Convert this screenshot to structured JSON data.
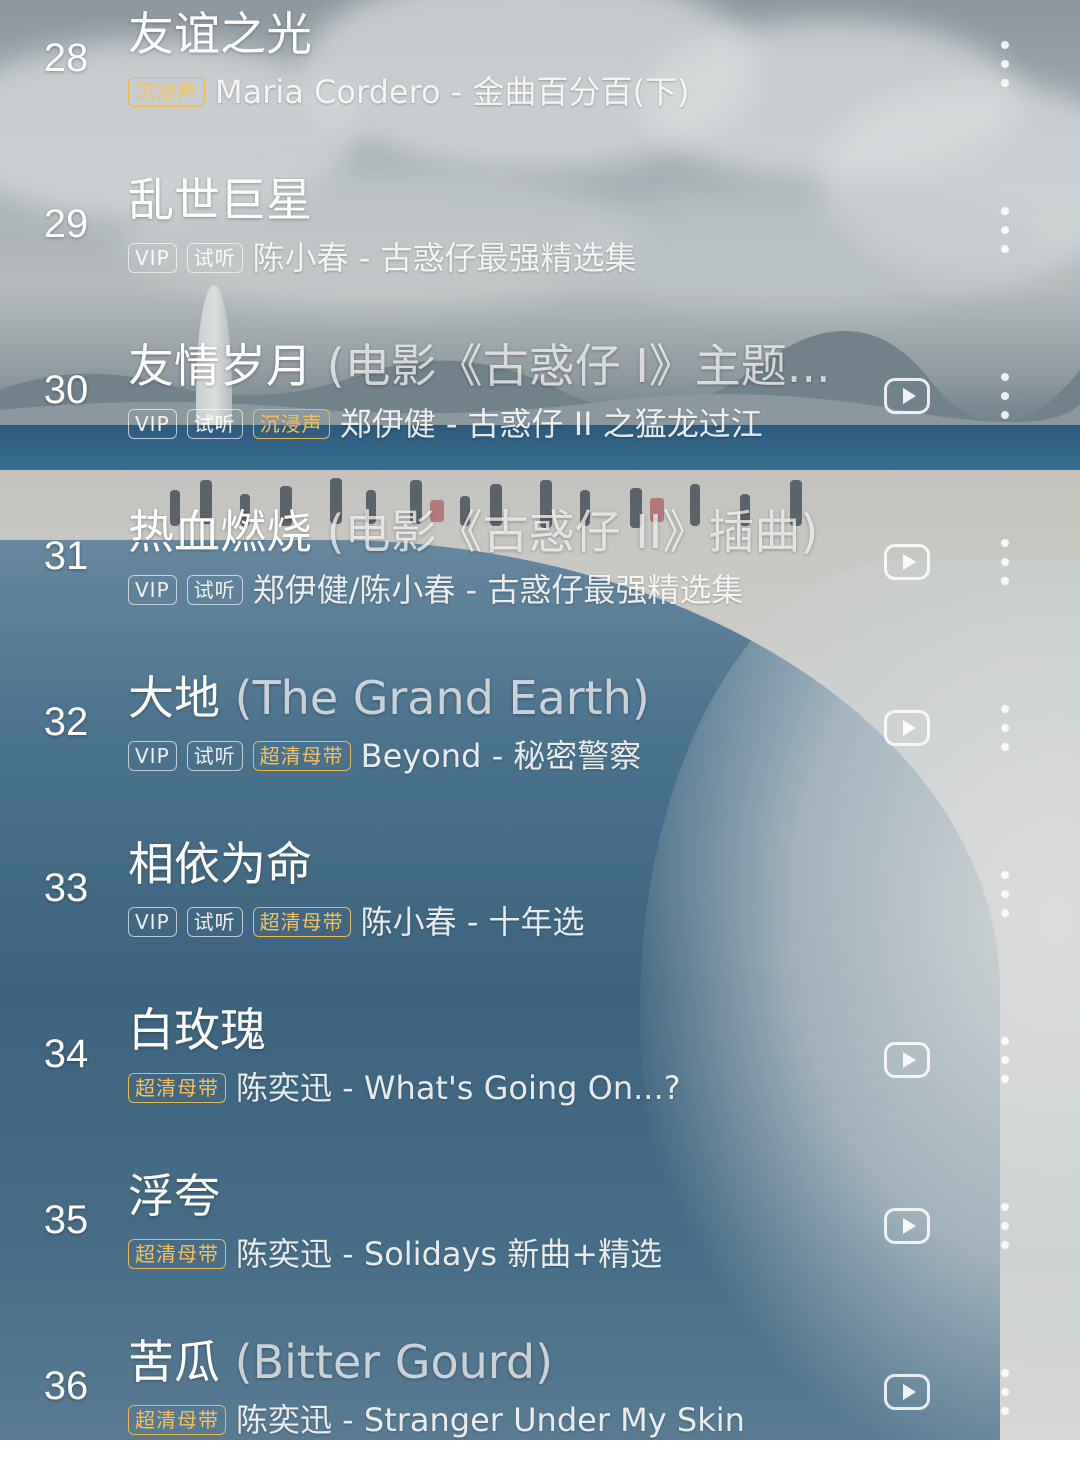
{
  "songs": [
    {
      "index": "28",
      "title": "友谊之光",
      "subtitle": "",
      "tags": [
        {
          "text": "沉浸声",
          "gold": true
        }
      ],
      "artist": "Maria Cordero - 金曲百分百(下)",
      "has_mv": false
    },
    {
      "index": "29",
      "title": "乱世巨星",
      "subtitle": "",
      "tags": [
        {
          "text": "VIP",
          "gold": false
        },
        {
          "text": "试听",
          "gold": false
        }
      ],
      "artist": "陈小春 - 古惑仔最强精选集",
      "has_mv": false
    },
    {
      "index": "30",
      "title": "友情岁月",
      "subtitle": "(电影《古惑仔 I》主题...",
      "tags": [
        {
          "text": "VIP",
          "gold": false
        },
        {
          "text": "试听",
          "gold": false
        },
        {
          "text": "沉浸声",
          "gold": true
        }
      ],
      "artist": "郑伊健 - 古惑仔 II 之猛龙过江",
      "has_mv": true
    },
    {
      "index": "31",
      "title": "热血燃烧",
      "subtitle": "(电影《古惑仔 II》插曲)",
      "tags": [
        {
          "text": "VIP",
          "gold": false
        },
        {
          "text": "试听",
          "gold": false
        }
      ],
      "artist": "郑伊健/陈小春 - 古惑仔最强精选集",
      "has_mv": true
    },
    {
      "index": "32",
      "title": "大地",
      "subtitle": "(The Grand Earth)",
      "tags": [
        {
          "text": "VIP",
          "gold": false
        },
        {
          "text": "试听",
          "gold": false
        },
        {
          "text": "超清母带",
          "gold": true
        }
      ],
      "artist": "Beyond - 秘密警察",
      "has_mv": true
    },
    {
      "index": "33",
      "title": "相依为命",
      "subtitle": "",
      "tags": [
        {
          "text": "VIP",
          "gold": false
        },
        {
          "text": "试听",
          "gold": false
        },
        {
          "text": "超清母带",
          "gold": true
        }
      ],
      "artist": "陈小春 - 十年选",
      "has_mv": false
    },
    {
      "index": "34",
      "title": "白玫瑰",
      "subtitle": "",
      "tags": [
        {
          "text": "超清母带",
          "gold": true
        }
      ],
      "artist": "陈奕迅 - What's Going On...?",
      "has_mv": true
    },
    {
      "index": "35",
      "title": "浮夸",
      "subtitle": "",
      "tags": [
        {
          "text": "超清母带",
          "gold": true
        }
      ],
      "artist": "陈奕迅 - Solidays 新曲+精选",
      "has_mv": true
    },
    {
      "index": "36",
      "title": "苦瓜",
      "subtitle": "(Bitter Gourd)",
      "tags": [
        {
          "text": "超清母带",
          "gold": true
        }
      ],
      "artist": "陈奕迅 - Stranger Under My Skin",
      "has_mv": true
    }
  ],
  "icons": {
    "mv": "play-video-icon",
    "more": "more-vertical-icon"
  },
  "colors": {
    "tag_gold": "#f6c05c",
    "text": "#ffffff"
  }
}
